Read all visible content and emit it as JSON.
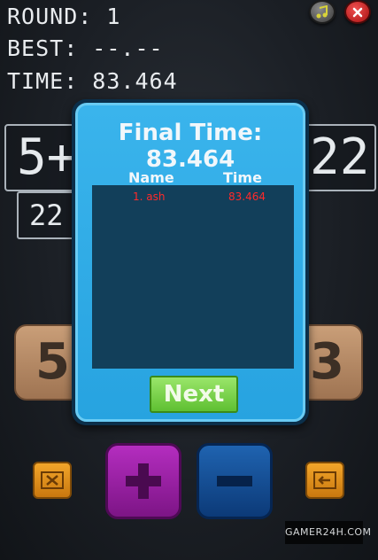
{
  "hud": {
    "round": "ROUND: 1",
    "best": "BEST: --.--",
    "time": "TIME: 83.464"
  },
  "top_buttons": {
    "music_icon": "music-note-icon",
    "close_icon": "close-icon"
  },
  "game": {
    "equation_left": "5+",
    "equation_right": "22",
    "target": "22",
    "tile_left": "5",
    "tile_right": "3"
  },
  "dialog": {
    "final_time": "Final Time: 83.464",
    "column_name": "Name",
    "column_time": "Time",
    "rows": [
      {
        "name": "1. ash",
        "time": "83.464"
      }
    ],
    "next_label": "Next"
  },
  "watermark": "GAMER24H.COM",
  "colors": {
    "dialog_blue": "#27a3e0",
    "score_text": "#ff2a2a",
    "next_green": "#5fc032",
    "plus_purple": "#b42dbf",
    "minus_blue": "#1f63b0",
    "tile_orange": "#f2a52a"
  }
}
